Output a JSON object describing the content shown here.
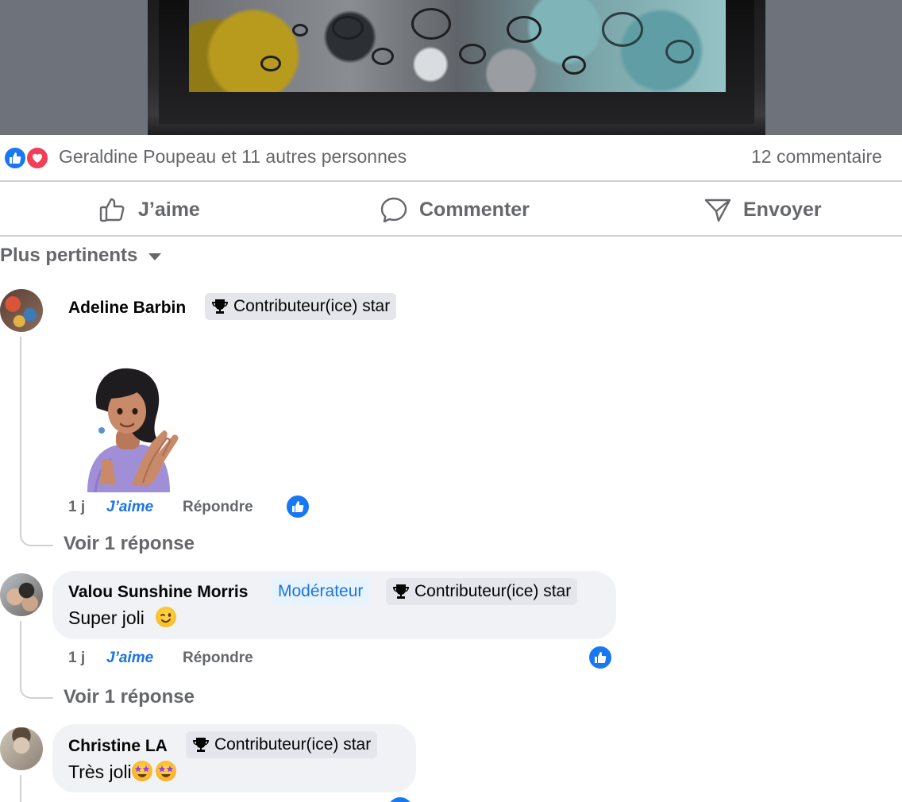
{
  "post": {
    "reactions_summary": "Geraldine Poupeau et 11 autres personnes",
    "comment_count": "12 commentaire"
  },
  "actions": {
    "like": "J’aime",
    "comment": "Commenter",
    "send": "Envoyer"
  },
  "sort": {
    "label": "Plus pertinents"
  },
  "comments": [
    {
      "author": "Adeline Barbin",
      "badges": [
        "Contributeur(ice) star"
      ],
      "sticker": "avatar-clapping-sticker",
      "time": "1 j",
      "like_label": "J’aime",
      "reply_label": "Répondre",
      "replies_label": "Voir 1 réponse"
    },
    {
      "author": "Valou Sunshine Morris",
      "role": "Modérateur",
      "badges": [
        "Contributeur(ice) star"
      ],
      "text": "Super joli",
      "time": "1 j",
      "like_label": "J’aime",
      "reply_label": "Répondre",
      "replies_label": "Voir 1 réponse"
    },
    {
      "author": "Christine LA",
      "badges": [
        "Contributeur(ice) star"
      ],
      "text": "Très joli"
    }
  ],
  "colors": {
    "accent": "#1b74e4",
    "like_blue": "#1877f2",
    "love_red": "#f33e58",
    "secondary_text": "#65676b",
    "bubble_bg": "#f0f2f5"
  }
}
